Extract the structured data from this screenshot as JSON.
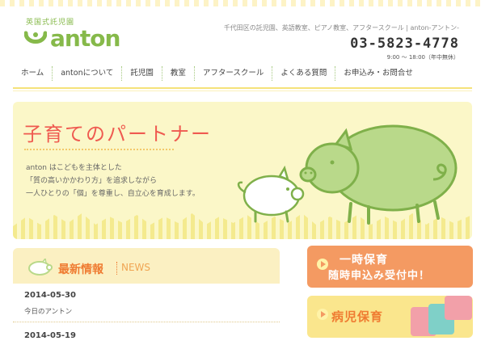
{
  "header": {
    "tagline": "英国式託児園",
    "logo_text": "anton",
    "site_description": "千代田区の託児園、英語教室、ピアノ教室、アフタースクール | anton-アントン-",
    "phone": "03-5823-4778",
    "hours": "9:00 ～ 18:00（年中無休）"
  },
  "nav": {
    "items": [
      {
        "label": "ホーム"
      },
      {
        "label": "antonについて"
      },
      {
        "label": "託児園"
      },
      {
        "label": "教室"
      },
      {
        "label": "アフタースクール"
      },
      {
        "label": "よくある質問"
      },
      {
        "label": "お申込み・お問合せ"
      }
    ]
  },
  "hero": {
    "title": "子育てのパートナー",
    "line1": "anton はこどもを主体とした",
    "line2": "「質の高いかかわり方」を追求しながら",
    "line3": "一人ひとりの「個」を尊重し、自立心を育成します。"
  },
  "news": {
    "title": "最新情報",
    "subtitle": "NEWS",
    "entries": [
      {
        "date": "2014-05-30",
        "text": "今日のアントン"
      },
      {
        "date": "2014-05-19",
        "text": ""
      }
    ]
  },
  "banners": {
    "temp_care_line1": "一時保育",
    "temp_care_line2": "随時申込み受付中！",
    "sick_care": "病児保育"
  },
  "colors": {
    "brand_green": "#86b94a",
    "hero_red": "#ef5a50",
    "orange": "#f49a62",
    "yellow_bg": "#fbf7c8"
  }
}
